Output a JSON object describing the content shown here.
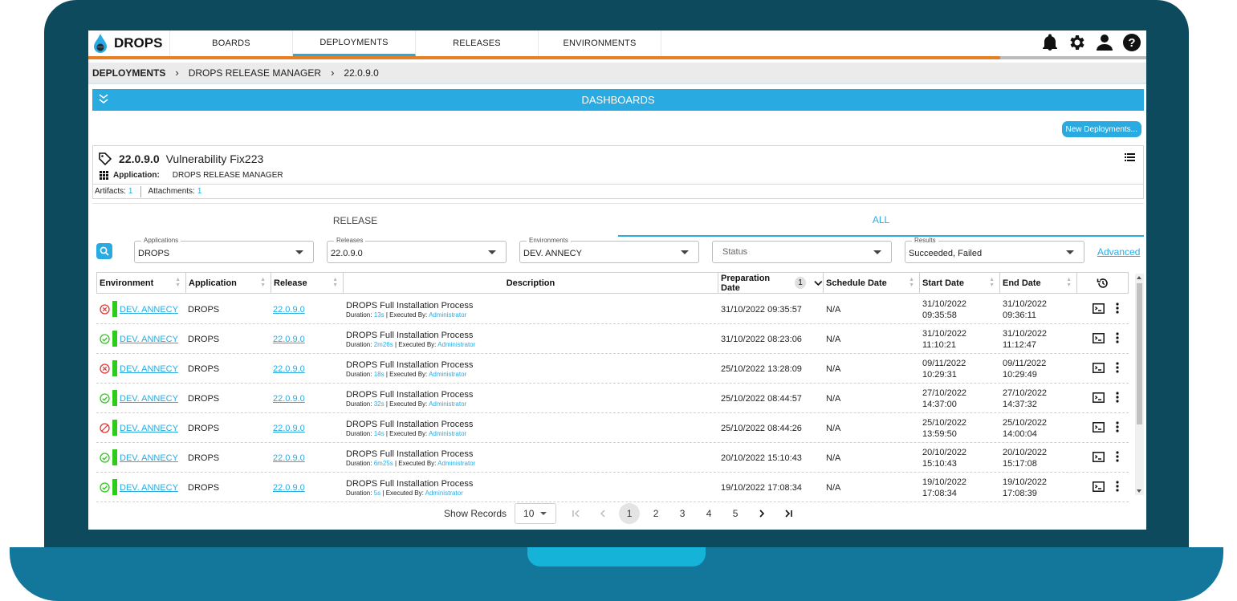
{
  "app": {
    "name": "DROPS"
  },
  "nav": {
    "tabs": [
      "BOARDS",
      "DEPLOYMENTS",
      "RELEASES",
      "ENVIRONMENTS"
    ],
    "active": "DEPLOYMENTS"
  },
  "breadcrumb": [
    "DEPLOYMENTS",
    "DROPS RELEASE MANAGER",
    "22.0.9.0"
  ],
  "dashboards_label": "DASHBOARDS",
  "new_deployment_label": "New Deployments...",
  "release": {
    "version": "22.0.9.0",
    "name": "Vulnerability Fix223",
    "application_label": "Application:",
    "application_value": "DROPS RELEASE MANAGER",
    "artifacts_label": "Artifacts:",
    "artifacts_count": "1",
    "attachments_label": "Attachments:",
    "attachments_count": "1"
  },
  "subtabs": [
    "RELEASE",
    "ALL"
  ],
  "filters": {
    "applications": {
      "label": "Applications",
      "value": "DROPS"
    },
    "releases": {
      "label": "Releases",
      "value": "22.0.9.0"
    },
    "environments": {
      "label": "Environments",
      "value": "DEV. ANNECY"
    },
    "status": {
      "placeholder": "Status"
    },
    "results": {
      "label": "Results",
      "value": "Succeeded, Failed"
    },
    "advanced_label": "Advanced"
  },
  "table": {
    "columns": [
      "Environment",
      "Application",
      "Release",
      "Description",
      "Preparation Date",
      "Schedule Date",
      "Start Date",
      "End Date"
    ],
    "sort_badge": "1",
    "rows": [
      {
        "status": "failed",
        "env": "DEV. ANNECY",
        "app": "DROPS",
        "release": "22.0.9.0",
        "desc": "DROPS Full Installation Process",
        "dur_label": "Duration:",
        "duration": "13s",
        "exec_label": "| Executed By:",
        "by": "Administrator",
        "prep": "31/10/2022 09:35:57",
        "sched": "N/A",
        "start_d": "31/10/2022",
        "start_t": "09:35:58",
        "end_d": "31/10/2022",
        "end_t": "09:36:11"
      },
      {
        "status": "success",
        "env": "DEV. ANNECY",
        "app": "DROPS",
        "release": "22.0.9.0",
        "desc": "DROPS Full Installation Process",
        "dur_label": "Duration:",
        "duration": "2m26s",
        "exec_label": "| Executed By:",
        "by": "Administrator",
        "prep": "31/10/2022 08:23:06",
        "sched": "N/A",
        "start_d": "31/10/2022",
        "start_t": "11:10:21",
        "end_d": "31/10/2022",
        "end_t": "11:12:47"
      },
      {
        "status": "failed",
        "env": "DEV. ANNECY",
        "app": "DROPS",
        "release": "22.0.9.0",
        "desc": "DROPS Full Installation Process",
        "dur_label": "Duration:",
        "duration": "18s",
        "exec_label": "| Executed By:",
        "by": "Administrator",
        "prep": "25/10/2022 13:28:09",
        "sched": "N/A",
        "start_d": "09/11/2022",
        "start_t": "10:29:31",
        "end_d": "09/11/2022",
        "end_t": "10:29:49"
      },
      {
        "status": "success",
        "env": "DEV. ANNECY",
        "app": "DROPS",
        "release": "22.0.9.0",
        "desc": "DROPS Full Installation Process",
        "dur_label": "Duration:",
        "duration": "32s",
        "exec_label": "| Executed By:",
        "by": "Administrator",
        "prep": "25/10/2022 08:44:57",
        "sched": "N/A",
        "start_d": "27/10/2022",
        "start_t": "14:37:00",
        "end_d": "27/10/2022",
        "end_t": "14:37:32"
      },
      {
        "status": "cancelled",
        "env": "DEV. ANNECY",
        "app": "DROPS",
        "release": "22.0.9.0",
        "desc": "DROPS Full Installation Process",
        "dur_label": "Duration:",
        "duration": "14s",
        "exec_label": "| Executed By:",
        "by": "Administrator",
        "prep": "25/10/2022 08:44:26",
        "sched": "N/A",
        "start_d": "25/10/2022",
        "start_t": "13:59:50",
        "end_d": "25/10/2022",
        "end_t": "14:00:04"
      },
      {
        "status": "success",
        "env": "DEV. ANNECY",
        "app": "DROPS",
        "release": "22.0.9.0",
        "desc": "DROPS Full Installation Process",
        "dur_label": "Duration:",
        "duration": "6m25s",
        "exec_label": "| Executed By:",
        "by": "Administrator",
        "prep": "20/10/2022 15:10:43",
        "sched": "N/A",
        "start_d": "20/10/2022",
        "start_t": "15:10:43",
        "end_d": "20/10/2022",
        "end_t": "15:17:08"
      },
      {
        "status": "success",
        "env": "DEV. ANNECY",
        "app": "DROPS",
        "release": "22.0.9.0",
        "desc": "DROPS Full Installation Process",
        "dur_label": "Duration:",
        "duration": "5s",
        "exec_label": "| Executed By:",
        "by": "Administrator",
        "prep": "19/10/2022 17:08:34",
        "sched": "N/A",
        "start_d": "19/10/2022",
        "start_t": "17:08:34",
        "end_d": "19/10/2022",
        "end_t": "17:08:39"
      }
    ]
  },
  "pagination": {
    "label": "Show Records",
    "page_size": "10",
    "pages": [
      "1",
      "2",
      "3",
      "4",
      "5"
    ],
    "current": "1"
  },
  "colors": {
    "accent": "#29abe2",
    "nav_progress": "#e67e22",
    "success": "#2ecc1a",
    "failed": "#e53935",
    "laptop_dark": "#0e4a5e",
    "laptop_base": "#12779a"
  },
  "icons": [
    "drops-logo-icon",
    "bell-icon",
    "gear-icon",
    "user-icon",
    "help-icon",
    "double-chevron-down-icon",
    "tag-icon",
    "grid-icon",
    "list-menu-icon",
    "search-icon",
    "history-icon",
    "terminal-icon",
    "more-vert-icon",
    "status-failed-icon",
    "status-success-icon",
    "status-cancelled-icon"
  ]
}
